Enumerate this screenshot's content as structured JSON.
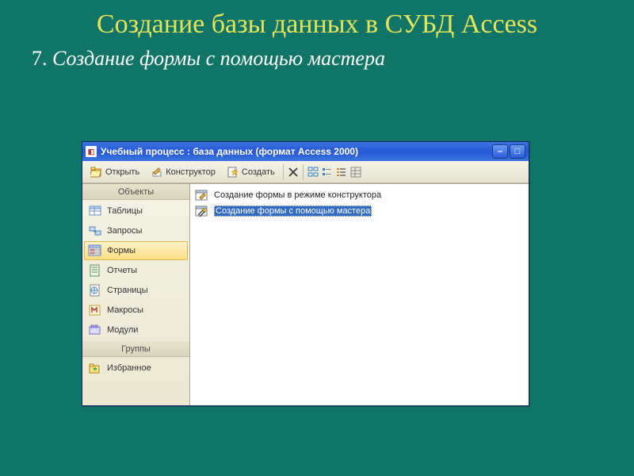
{
  "slide": {
    "title": "Создание базы данных в СУБД Access",
    "step_num": "7.",
    "step_text": "Создание формы с помощью мастера"
  },
  "window": {
    "title": "Учебный процесс : база данных (формат Access 2000)"
  },
  "toolbar": {
    "open": "Открыть",
    "design": "Конструктор",
    "create": "Создать"
  },
  "sidebar": {
    "group_objects": "Объекты",
    "group_groups": "Группы",
    "items": [
      {
        "label": "Таблицы"
      },
      {
        "label": "Запросы"
      },
      {
        "label": "Формы"
      },
      {
        "label": "Отчеты"
      },
      {
        "label": "Страницы"
      },
      {
        "label": "Макросы"
      },
      {
        "label": "Модули"
      }
    ],
    "favorites": "Избранное"
  },
  "content": {
    "items": [
      {
        "label": "Создание формы в режиме конструктора"
      },
      {
        "label": "Создание формы с помощью мастера"
      }
    ]
  }
}
